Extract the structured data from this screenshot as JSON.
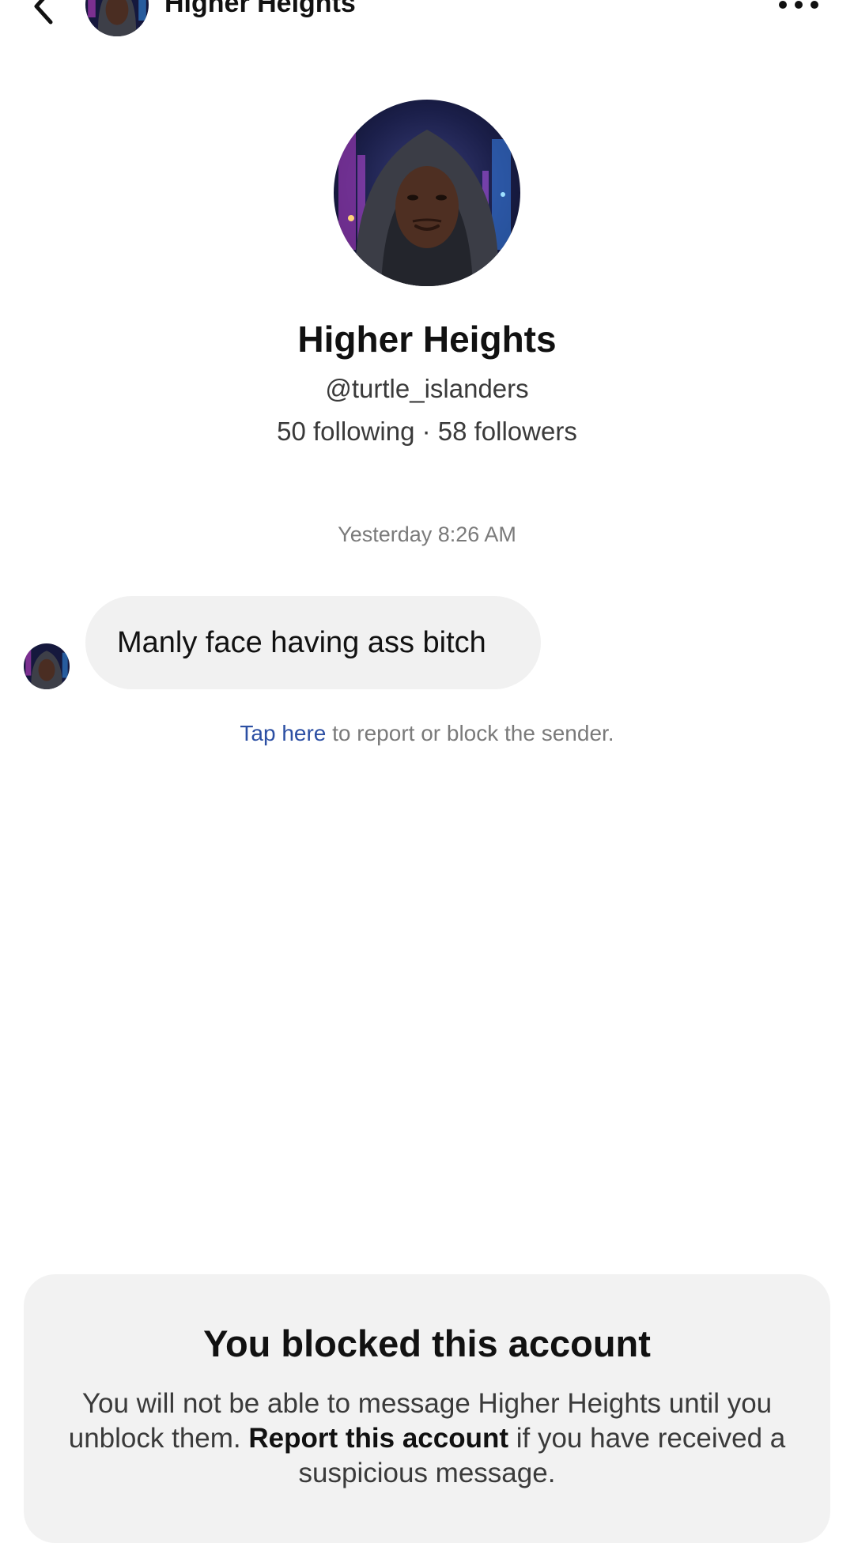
{
  "header": {
    "title": "Higher Heights",
    "back_icon": "chevron-left-icon",
    "more_icon": "more-horizontal-icon"
  },
  "profile": {
    "name": "Higher Heights",
    "handle": "@turtle_islanders",
    "stats": "50 following · 58 followers"
  },
  "conversation": {
    "timestamp": "Yesterday 8:26 AM",
    "messages": [
      {
        "text": "Manly face having ass bitch"
      }
    ],
    "report_link": "Tap here",
    "report_suffix": " to report or block the sender."
  },
  "blocked_notice": {
    "title": "You blocked this account",
    "text_before": "You will not be able to message Higher Heights until you unblock them. ",
    "report_label": "Report this account",
    "text_after": " if you have received a suspicious message."
  },
  "colors": {
    "background": "#ffffff",
    "bubble": "#f1f1f1",
    "link": "#2c4fa3",
    "card": "#f2f2f2",
    "muted_text": "#7a7a7a"
  }
}
